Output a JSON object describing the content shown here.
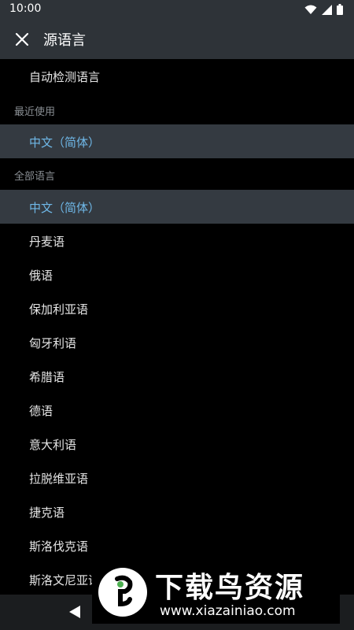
{
  "status_bar": {
    "time": "10:00"
  },
  "app_bar": {
    "title": "源语言",
    "close_icon": "close-icon"
  },
  "auto_detect": {
    "label": "自动检测语言"
  },
  "recent": {
    "header": "最近使用",
    "items": [
      {
        "label": "中文（简体）",
        "selected": true
      }
    ]
  },
  "all": {
    "header": "全部语言",
    "items": [
      {
        "label": "中文（简体）",
        "selected": true
      },
      {
        "label": "丹麦语"
      },
      {
        "label": "俄语"
      },
      {
        "label": "保加利亚语"
      },
      {
        "label": "匈牙利语"
      },
      {
        "label": "希腊语"
      },
      {
        "label": "德语"
      },
      {
        "label": "意大利语"
      },
      {
        "label": "拉脱维亚语"
      },
      {
        "label": "捷克语"
      },
      {
        "label": "斯洛伐克语"
      },
      {
        "label": "斯洛文尼亚语"
      }
    ]
  },
  "colors": {
    "bar_bg": "#2e3338",
    "selected_bg": "#343a41",
    "selected_text": "#6fb8e8",
    "header_text": "#8a8f94"
  },
  "watermark": {
    "title": "下载鸟资源",
    "url": "www.xiazainiao.com"
  },
  "nav_bar": {
    "back_icon": "back-triangle-icon"
  }
}
